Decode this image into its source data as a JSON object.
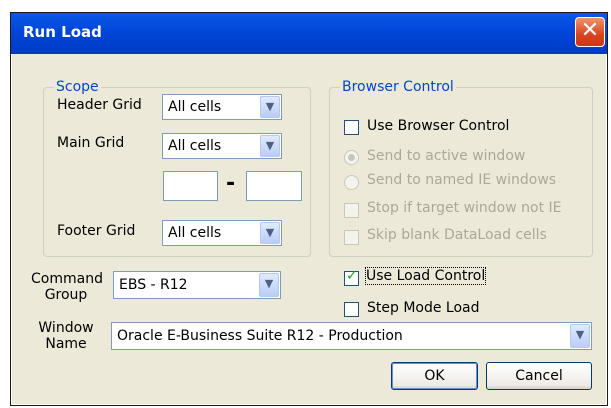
{
  "window": {
    "title": "Run Load",
    "close_glyph": "✕"
  },
  "scope": {
    "legend": "Scope",
    "header_grid": {
      "label": "Header Grid",
      "value": "All cells"
    },
    "main_grid": {
      "label": "Main Grid",
      "value": "All cells",
      "range_from": "",
      "range_to": "",
      "range_separator": "-"
    },
    "footer_grid": {
      "label": "Footer Grid",
      "value": "All cells"
    }
  },
  "browser_control": {
    "legend": "Browser Control",
    "use_browser_control": {
      "label": "Use Browser Control",
      "checked": false
    },
    "send_active": {
      "label": "Send to active window",
      "selected": true,
      "enabled": false
    },
    "send_named": {
      "label": "Send to named IE windows",
      "selected": false,
      "enabled": false
    },
    "stop_if_not_ie": {
      "label": "Stop if target window not IE",
      "checked": false,
      "enabled": false
    },
    "skip_blank": {
      "label": "Skip blank DataLoad cells",
      "checked": false,
      "enabled": false
    }
  },
  "command_group": {
    "label_line1": "Command",
    "label_line2": "Group",
    "value": "EBS - R12"
  },
  "use_load_control": {
    "label": "Use Load Control",
    "checked": true
  },
  "step_mode_load": {
    "label": "Step Mode Load",
    "checked": false
  },
  "window_name": {
    "label_line1": "Window",
    "label_line2": "Name",
    "value": "Oracle E-Business Suite R12 - Production"
  },
  "buttons": {
    "ok": "OK",
    "cancel": "Cancel"
  },
  "icons": {
    "combo_arrow": "chevron-down-icon",
    "check": "checkmark-icon"
  },
  "colors": {
    "titlebar": "#0046d8",
    "legend_text": "#0046d5",
    "client_bg": "#ece9d8",
    "close_button": "#d9441e"
  }
}
